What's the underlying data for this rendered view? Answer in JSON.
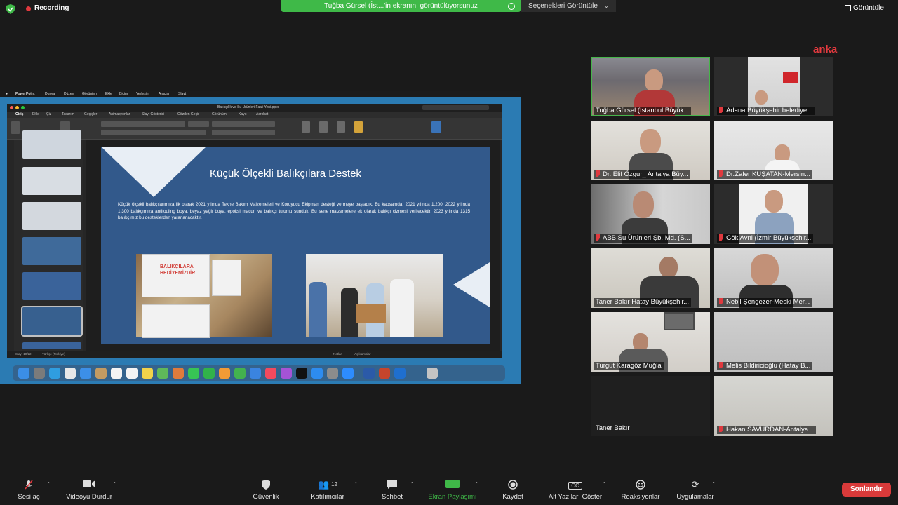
{
  "topbar": {
    "recording_label": "Recording",
    "share_banner": "Tuğba Gürsel (İst...'in ekranını görüntülüyorsunuz",
    "view_options": "Seçenekleri Görüntüle",
    "view_button": "Görüntüle"
  },
  "watermark": "anka",
  "shared_screen": {
    "window_title": "Balıkçılık ve Su Ürünleri Faali Yeni.pptx",
    "menu_items": [
      "PowerPoint",
      "Dosya",
      "Düzen",
      "Görünüm",
      "Ekle",
      "Biçim",
      "Yerleşim",
      "Araçlar",
      "Slayt"
    ],
    "ribbon_tabs": [
      "Giriş",
      "Ekle",
      "Çiz",
      "Tasarım",
      "Geçişler",
      "Animasyonlar",
      "Slayt Gösterisi",
      "Gözden Geçir",
      "Görünüm",
      "Kayıt",
      "Acrobat"
    ],
    "slide": {
      "title": "Küçük Ölçekli Balıkçılara Destek",
      "body": "Küçük ölçekli balıkçılarımıza ilk olarak 2021 yılında Tekne Bakım Malzemeleri ve Koruyucu Ekipman desteği vermeye başladık. Bu kapsamda; 2021 yılında 1.200, 2022 yılında 1.300 balıkçımıza antifouling boya, beyaz yağlı boya, epoksi macun ve balıkçı tulumu sunduk. Bu sene malzemelere ek olarak balıkçı çizmesi verilecektir. 2023 yılında 1315 balıkçımız bu desteklerden yararlanacaktır.",
      "box_label": "BALIKÇILARA HEDİYEMİZDİR"
    },
    "status_left": "Slayt 10/22",
    "status_lang": "Türkçe (Türkiye)",
    "status_notes": "Notlar",
    "status_comments": "Açıklamalar"
  },
  "participants": [
    {
      "name": "Tuğba Gürsel (İstanbul Büyük...",
      "muted": false,
      "speaking": true
    },
    {
      "name": "Adana Büyükşehir belediye...",
      "muted": true,
      "speaking": false
    },
    {
      "name": "Dr. Elif Özgur_ Antalya Büy...",
      "muted": true,
      "speaking": false
    },
    {
      "name": "Dr.Zafer KUŞATAN-Mersin...",
      "muted": true,
      "speaking": false
    },
    {
      "name": "ABB Su Ürünleri Şb. Md. (S...",
      "muted": true,
      "speaking": false
    },
    {
      "name": "Gök Avni (İzmir Büyükşehir...",
      "muted": true,
      "speaking": false
    },
    {
      "name": "Taner Bakır Hatay Büyükşehir...",
      "muted": false,
      "speaking": false
    },
    {
      "name": "Nebil Şengezer-Meski Mer...",
      "muted": true,
      "speaking": false
    },
    {
      "name": "Turgut Karagöz Muğla",
      "muted": false,
      "speaking": false
    },
    {
      "name": "Melis Bildiricioğlu (Hatay B...",
      "muted": true,
      "speaking": false
    },
    {
      "name": "Taner Bakır",
      "muted": false,
      "speaking": false
    },
    {
      "name": "Hakan SAVURDAN-Antalya...",
      "muted": true,
      "speaking": false
    }
  ],
  "toolbar": {
    "mute": "Sesi aç",
    "video": "Videoyu Durdur",
    "security": "Güvenlik",
    "participants": "Katılımcılar",
    "participants_count": "12",
    "chat": "Sohbet",
    "share": "Ekran Paylaşımı",
    "record": "Kaydet",
    "captions": "Alt Yazıları Göster",
    "captions_badge": "CC",
    "reactions": "Reaksiyonlar",
    "apps": "Uygulamalar",
    "end": "Sonlandır"
  },
  "colors": {
    "share_green": "#3fb948",
    "end_red": "#d93a3a",
    "slide_blue": "#32598b",
    "muted_red": "#e0393e"
  }
}
